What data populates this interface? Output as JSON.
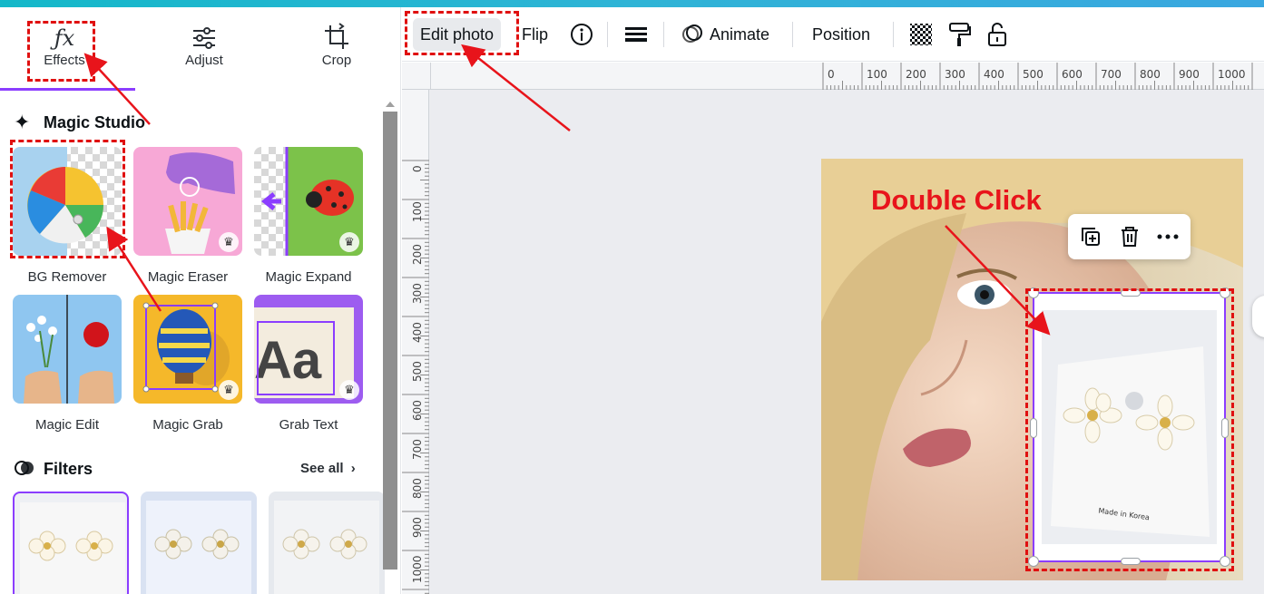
{
  "panel": {
    "tabs": [
      {
        "label": "Effects",
        "icon": "fx-icon"
      },
      {
        "label": "Adjust",
        "icon": "sliders-icon"
      },
      {
        "label": "Crop",
        "icon": "crop-icon"
      }
    ],
    "magic_studio": {
      "title": "Magic Studio",
      "tools": [
        {
          "label": "BG Remover"
        },
        {
          "label": "Magic Eraser",
          "premium": true
        },
        {
          "label": "Magic Expand",
          "premium": true
        },
        {
          "label": "Magic Edit"
        },
        {
          "label": "Magic Grab",
          "premium": true
        },
        {
          "label": "Grab Text",
          "premium": true
        }
      ]
    },
    "filters": {
      "title": "Filters",
      "see_all": "See all"
    }
  },
  "toolbar": {
    "edit_photo": "Edit photo",
    "flip": "Flip",
    "animate": "Animate",
    "position": "Position"
  },
  "ruler": {
    "horizontal": [
      "0",
      "100",
      "200",
      "300",
      "400",
      "500",
      "600",
      "700",
      "800",
      "900",
      "1000"
    ],
    "vertical": [
      "0",
      "100",
      "200",
      "300",
      "400",
      "500",
      "600",
      "700",
      "800",
      "900",
      "1000"
    ]
  },
  "photo": {
    "product_caption": "Made in Korea"
  },
  "annotation": {
    "double_click": "Double Click"
  },
  "colors": {
    "accent": "#8b3dff",
    "annotation": "#e8141b"
  }
}
